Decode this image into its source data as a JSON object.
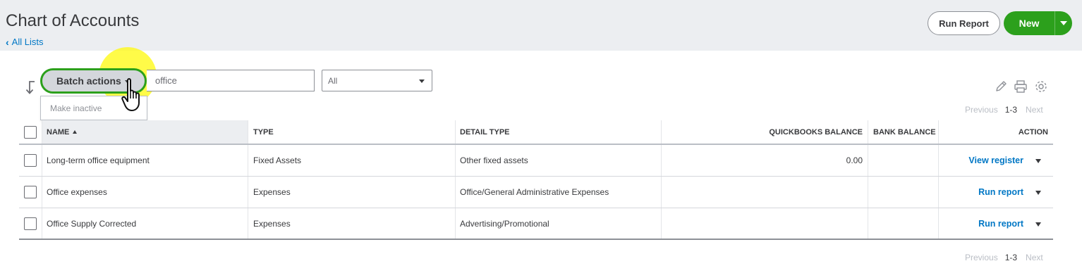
{
  "header": {
    "title": "Chart of Accounts",
    "back_link": "All Lists",
    "run_report_label": "Run Report",
    "new_label": "New"
  },
  "toolbar": {
    "batch_actions_label": "Batch actions",
    "batch_menu_item": "Make inactive",
    "search_value": "office",
    "filter_value": "All",
    "icons": [
      "pencil-icon",
      "printer-icon",
      "gear-icon"
    ]
  },
  "pagination_top": {
    "prev": "Previous",
    "range": "1-3",
    "next": "Next"
  },
  "pagination_bottom": {
    "prev": "Previous",
    "range": "1-3",
    "next": "Next"
  },
  "table": {
    "columns": [
      "NAME",
      "TYPE",
      "DETAIL TYPE",
      "QUICKBOOKS BALANCE",
      "BANK BALANCE",
      "ACTION"
    ],
    "rows": [
      {
        "name": "Long-term office equipment",
        "type": "Fixed Assets",
        "detail_type": "Other fixed assets",
        "qb_balance": "0.00",
        "bank_balance": "",
        "action": "View register"
      },
      {
        "name": "Office expenses",
        "type": "Expenses",
        "detail_type": "Office/General Administrative Expenses",
        "qb_balance": "",
        "bank_balance": "",
        "action": "Run report"
      },
      {
        "name": "Office Supply Corrected",
        "type": "Expenses",
        "detail_type": "Advertising/Promotional",
        "qb_balance": "",
        "bank_balance": "",
        "action": "Run report"
      }
    ]
  },
  "colors": {
    "brand_green": "#2ca01c",
    "link_blue": "#0077c5",
    "header_bg": "#eceef1",
    "highlight": "#fffa14"
  }
}
